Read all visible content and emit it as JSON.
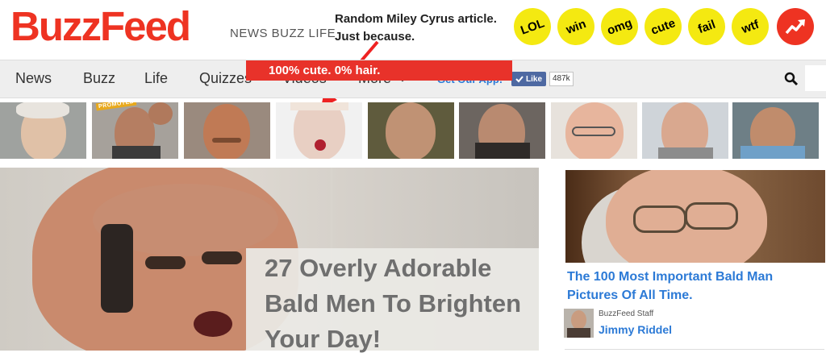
{
  "header": {
    "logo": "BuzzFeed",
    "tagline": "NEWS BUZZ LIFE",
    "callout_line1": "Random Miley Cyrus article.",
    "callout_line2": "Just because.",
    "badges": [
      "LOL",
      "win",
      "omg",
      "cute",
      "fail",
      "wtf"
    ],
    "trending_icon": "trending-arrow-icon"
  },
  "nav": {
    "items": [
      "News",
      "Buzz",
      "Life",
      "Quizzes",
      "Videos",
      "More"
    ],
    "more_icon": "chevron-down-icon",
    "get_app": "Get Our App!",
    "like_label": "Like",
    "like_count": "487k",
    "search_icon": "search-icon"
  },
  "thumbnails": {
    "promoted_label": "PROMOTED"
  },
  "hero": {
    "label": "100% cute. 0% hair.",
    "title": "27 Overly Adorable Bald Men To Brighten Your Day!"
  },
  "sidebar": {
    "title": "The 100 Most Important Bald Man Pictures Of All Time.",
    "author_role": "BuzzFeed Staff",
    "author_name": "Jimmy Riddel"
  },
  "colors": {
    "brand_red": "#ee3322",
    "badge_yellow": "#f4e911",
    "link_blue": "#2c7ad6",
    "nav_bg": "#eeeeee"
  }
}
